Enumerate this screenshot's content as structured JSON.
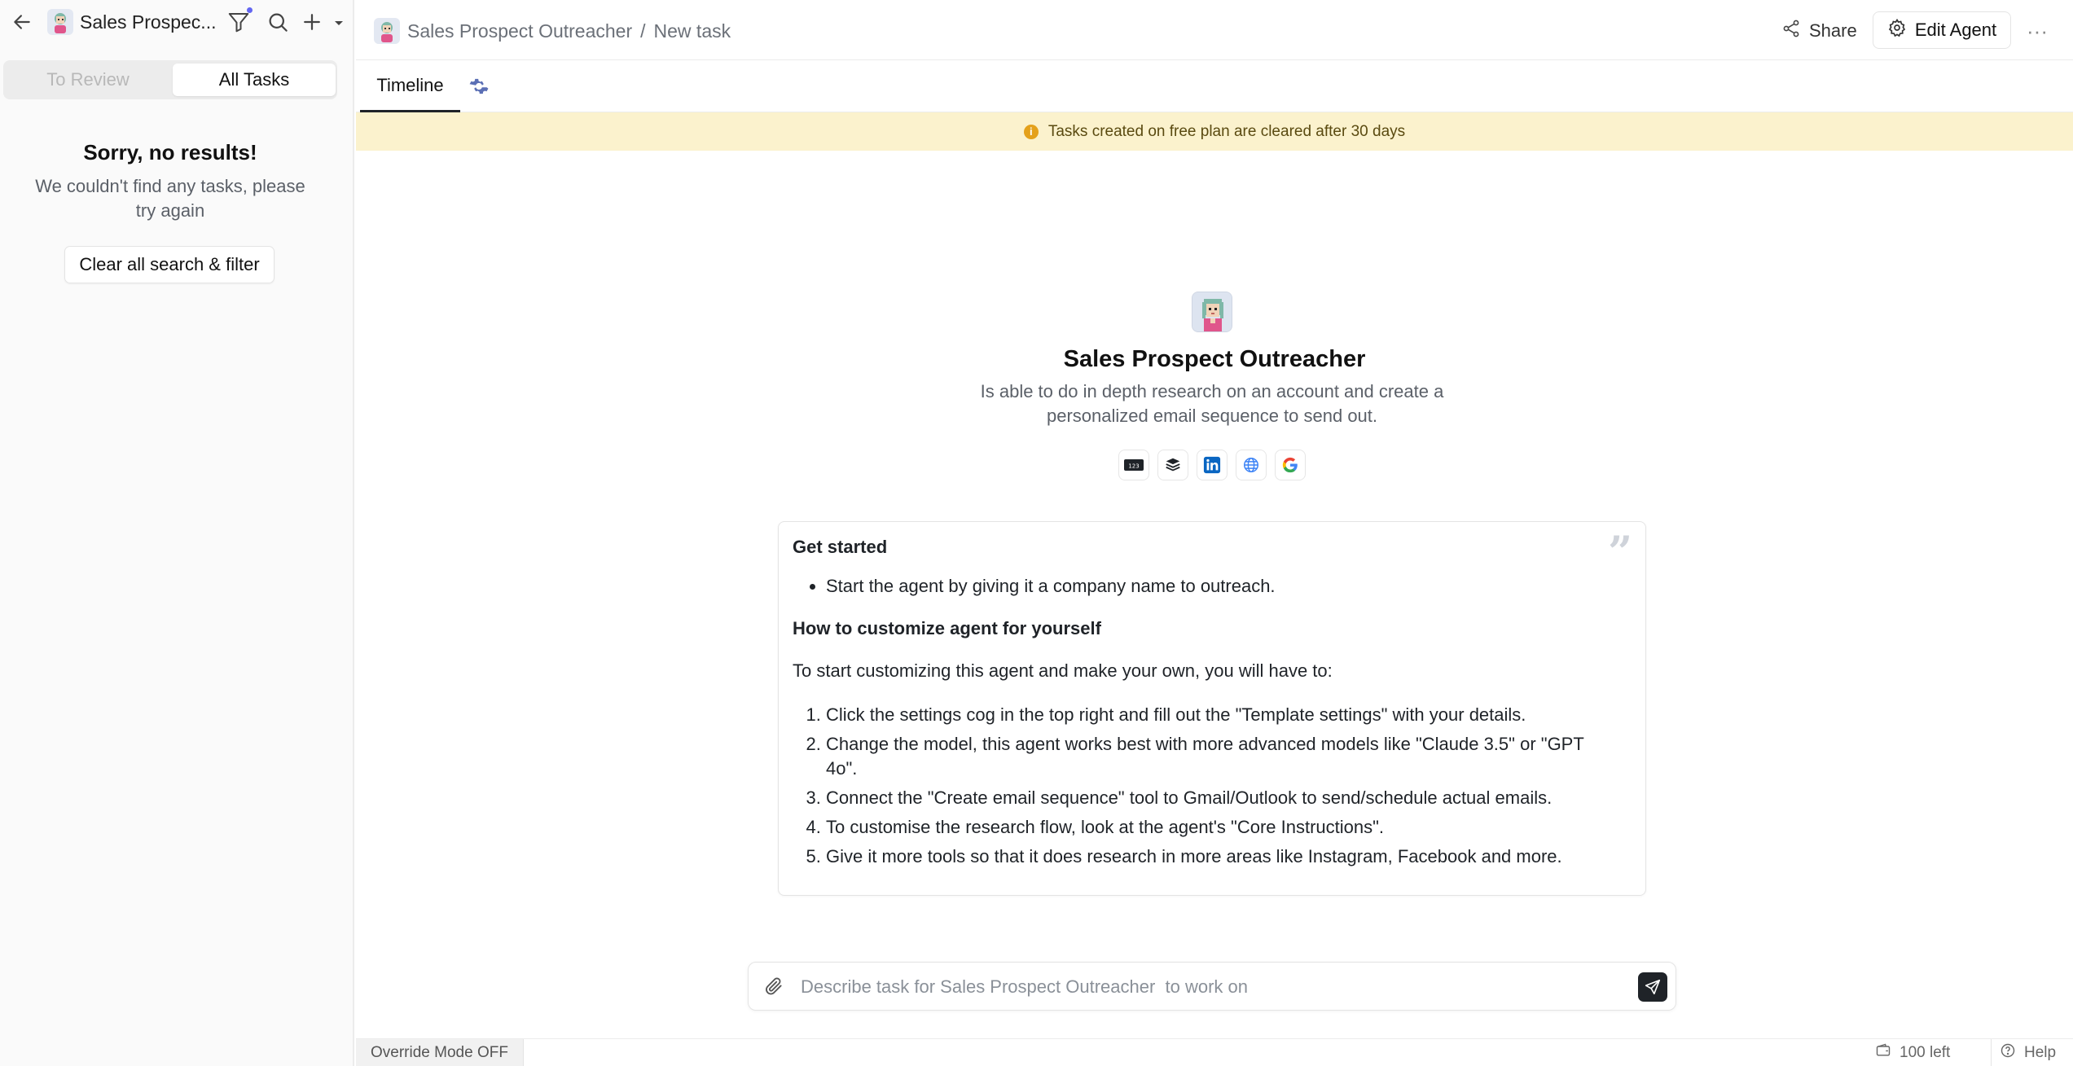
{
  "sidebar": {
    "title": "Sales Prospec...",
    "tabs": [
      {
        "label": "To Review"
      },
      {
        "label": "All Tasks"
      }
    ],
    "active_tab": "All Tasks",
    "empty": {
      "title": "Sorry, no results!",
      "description": "We couldn't find any tasks, please try again",
      "clear_button": "Clear all search & filter"
    }
  },
  "header": {
    "breadcrumb_agent": "Sales Prospect Outreacher",
    "breadcrumb_sep": "/",
    "breadcrumb_page": "New task",
    "share_label": "Share",
    "edit_agent_label": "Edit Agent",
    "more_label": "···"
  },
  "tabs": {
    "timeline_label": "Timeline"
  },
  "banner": {
    "icon_text": "i",
    "text": "Tasks created on free plan are cleared after 30 days",
    "color": "#fbf2cd"
  },
  "agent": {
    "name": "Sales Prospect Outreacher",
    "description": "Is able to do in depth research on an account and create a personalized email sequence to send out.",
    "tools": [
      {
        "name": "counter-tool-icon",
        "text": "123"
      },
      {
        "name": "stack-tool-icon"
      },
      {
        "name": "linkedin-icon"
      },
      {
        "name": "globe-icon"
      },
      {
        "name": "google-icon"
      }
    ]
  },
  "card": {
    "heading1": "Get started",
    "bullets": [
      "Start the agent by giving it a company name to outreach."
    ],
    "heading2": "How to customize agent for yourself",
    "intro": "To start customizing this agent and make your own, you will have to:",
    "steps": [
      "Click the settings cog in the top right and fill out the \"Template settings\" with your details.",
      "Change the model, this agent works best with more advanced models like \"Claude 3.5\" or \"GPT 4o\".",
      "Connect the \"Create email sequence\" tool to Gmail/Outlook to send/schedule actual emails.",
      "To customise the research flow, look at the agent's \"Core Instructions\".",
      "Give it more tools so that it does research in more areas like Instagram, Facebook and more."
    ]
  },
  "input": {
    "placeholder": "Describe task for Sales Prospect Outreacher  to work on",
    "value": ""
  },
  "footer": {
    "override_label": "Override Mode OFF",
    "credits_label": "100 left",
    "help_label": "Help"
  },
  "colors": {
    "accent_dot": "#6366f1",
    "warning": "#e4a11b",
    "send_button": "#1f2328"
  }
}
